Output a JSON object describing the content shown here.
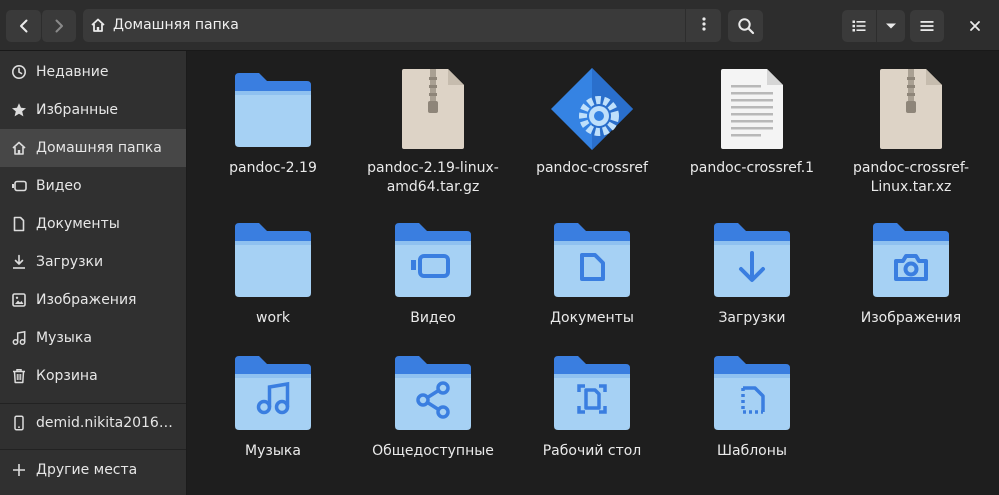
{
  "header": {
    "path_label": "Домашняя папка",
    "icons": [
      "back-icon",
      "forward-icon",
      "home-icon",
      "more-vert-icon",
      "search-icon",
      "list-view-icon",
      "chevron-down-icon",
      "hamburger-menu-icon",
      "close-icon"
    ]
  },
  "sidebar": {
    "items": [
      {
        "label": "Недавние",
        "icon": "clock-icon"
      },
      {
        "label": "Избранные",
        "icon": "star-icon"
      },
      {
        "label": "Домашняя папка",
        "icon": "home-icon",
        "active": true
      },
      {
        "label": "Видео",
        "icon": "video-icon"
      },
      {
        "label": "Документы",
        "icon": "document-icon"
      },
      {
        "label": "Загрузки",
        "icon": "download-icon"
      },
      {
        "label": "Изображения",
        "icon": "image-icon"
      },
      {
        "label": "Музыка",
        "icon": "music-icon"
      },
      {
        "label": "Корзина",
        "icon": "trash-icon"
      },
      {
        "label": "demid.nikita2016…",
        "icon": "phone-icon"
      },
      {
        "label": "Другие места",
        "icon": "plus-icon"
      }
    ]
  },
  "files": [
    {
      "label": "pandoc-2.19",
      "type": "folder"
    },
    {
      "label": "pandoc-2.19-linux-amd64.tar.gz",
      "type": "archive"
    },
    {
      "label": "pandoc-crossref",
      "type": "executable"
    },
    {
      "label": "pandoc-crossref.1",
      "type": "text"
    },
    {
      "label": "pandoc-crossref-Linux.tar.xz",
      "type": "archive"
    },
    {
      "label": "work",
      "type": "folder"
    },
    {
      "label": "Видео",
      "type": "folder-video"
    },
    {
      "label": "Документы",
      "type": "folder-documents"
    },
    {
      "label": "Загрузки",
      "type": "folder-download"
    },
    {
      "label": "Изображения",
      "type": "folder-pictures"
    },
    {
      "label": "Музыка",
      "type": "folder-music"
    },
    {
      "label": "Общедоступные",
      "type": "folder-public"
    },
    {
      "label": "Рабочий стол",
      "type": "folder-desktop"
    },
    {
      "label": "Шаблоны",
      "type": "folder-templates"
    }
  ],
  "colors": {
    "folder_back": "#3a7ee0",
    "folder_front_top": "#8fc1f0",
    "folder_front_bottom": "#a8d4f5",
    "folder_emblem": "#3a7ee0",
    "archive_bg": "#ddd3c6",
    "exec_blue": "#3583e3"
  }
}
